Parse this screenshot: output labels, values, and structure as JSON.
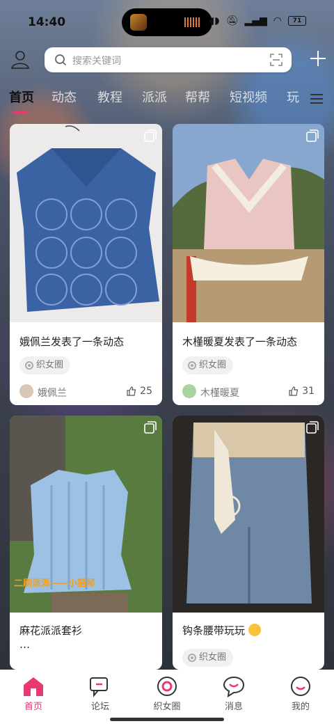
{
  "status": {
    "time": "14:40",
    "battery": "71"
  },
  "search": {
    "placeholder": "搜索关键词"
  },
  "tabs": [
    "首页",
    "动态",
    "教程",
    "派派",
    "帮帮",
    "短视频",
    "玩"
  ],
  "cards": [
    {
      "title": "娥佩兰发表了一条动态",
      "tag": "织女圈",
      "author": "娥佩兰",
      "likes": "25"
    },
    {
      "title": "木槿暖夏发表了一条动态",
      "tag": "织女圈",
      "author": "木槿暖夏",
      "likes": "31"
    },
    {
      "title": "麻花派派套衫",
      "extra": "…",
      "overlay": "二刷派派——小猫琴"
    },
    {
      "title": "钩条腰带玩玩",
      "tag": "织女圈"
    }
  ],
  "nav": {
    "home": "首页",
    "forum": "论坛",
    "circle": "织女圈",
    "messages": "消息",
    "me": "我的"
  },
  "colors": {
    "accent": "#e83a6e",
    "card_bg": "#ffffff"
  }
}
